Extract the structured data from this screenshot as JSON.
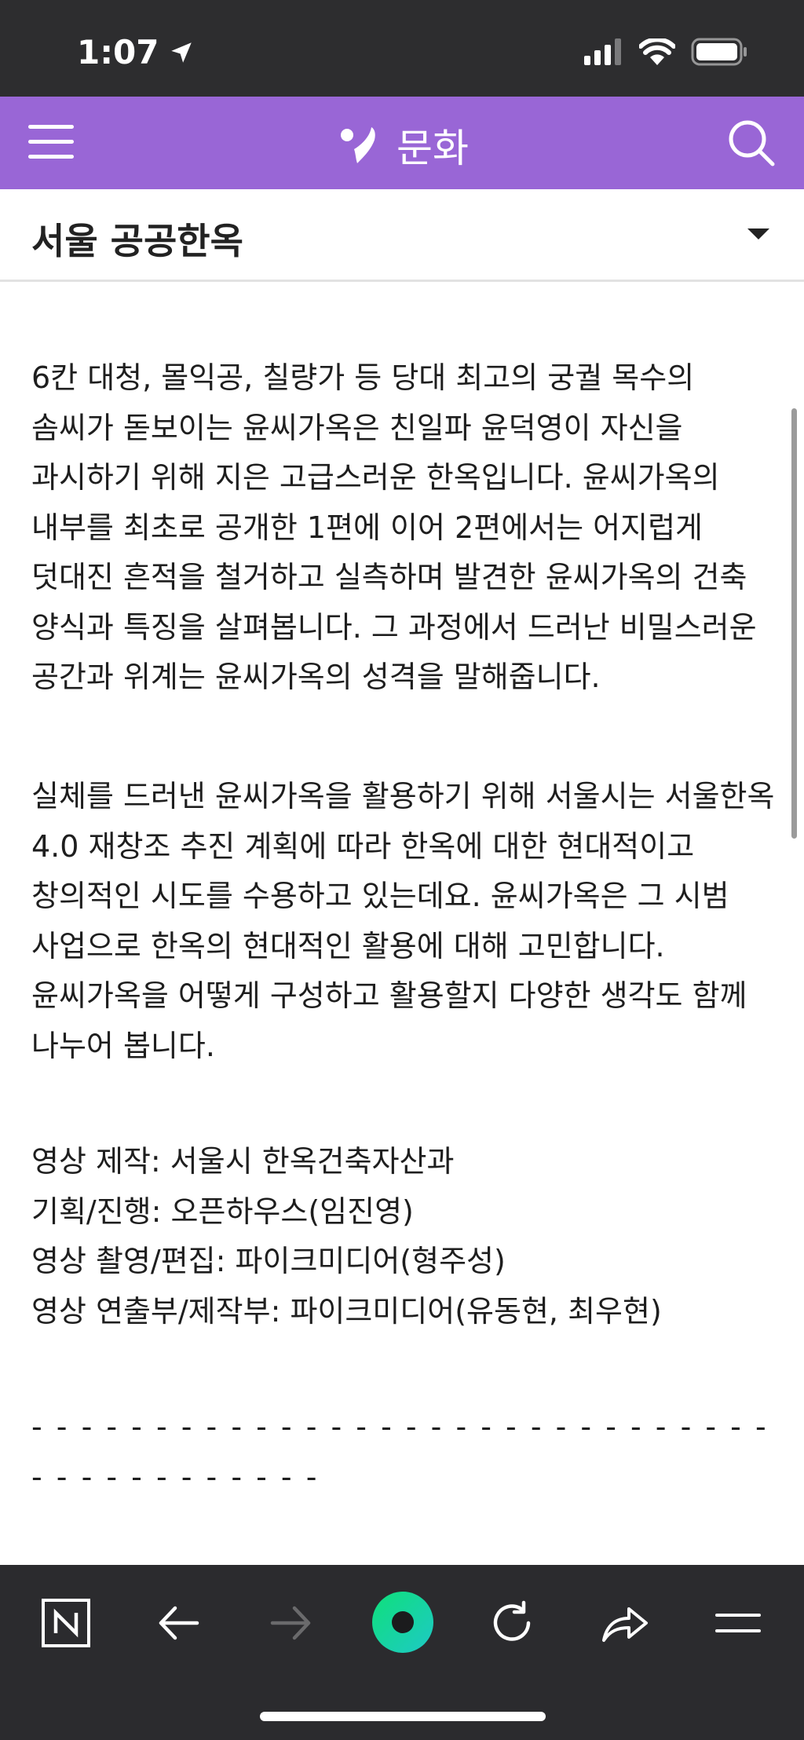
{
  "status_bar": {
    "time": "1:07"
  },
  "header": {
    "title": "문화",
    "accent_color": "#9966d6",
    "menu_icon": "hamburger-menu-icon",
    "search_icon": "search-icon",
    "logo_icon": "naver-culture-logo-icon"
  },
  "section": {
    "title": "서울 공공한옥"
  },
  "article": {
    "paragraph_1": "6칸 대청, 몰익공, 칠량가 등 당대 최고의 궁궐 목수의 솜씨가 돋보이는 윤씨가옥은 친일파 윤덕영이 자신을 과시하기 위해 지은 고급스러운 한옥입니다. 윤씨가옥의 내부를 최초로 공개한 1편에 이어 2편에서는 어지럽게 덧대진 흔적을 철거하고 실측하며 발견한 윤씨가옥의 건축 양식과 특징을 살펴봅니다. 그 과정에서 드러난 비밀스러운 공간과 위계는 윤씨가옥의 성격을 말해줍니다.",
    "paragraph_2": "실체를 드러낸 윤씨가옥을 활용하기 위해 서울시는 서울한옥 4.0 재창조 추진 계획에 따라 한옥에 대한 현대적이고 창의적인 시도를 수용하고 있는데요. 윤씨가옥은 그 시범 사업으로 한옥의 현대적인 활용에 대해 고민합니다. 윤씨가옥을 어떻게 구성하고 활용할지 다양한 생각도 함께 나누어 봅니다.",
    "credits": [
      "영상 제작: 서울시 한옥건축자산과",
      "기획/진행: 오픈하우스(임진영)",
      "영상 촬영/편집: 파이크미디어(형주성)",
      "영상 연출부/제작부: 파이크미디어(유동현, 최우현)"
    ],
    "divider": "- - - - - - - - - - - - - - - - - - - - - - - - - - - - - - - - - - - - - - - - - -"
  },
  "browser_toolbar": {
    "buttons": [
      "naver-home-icon",
      "back-arrow-icon",
      "forward-arrow-icon",
      "green-dot-icon",
      "reload-icon",
      "share-icon",
      "more-menu-icon"
    ],
    "green_color": "#19d49a"
  }
}
